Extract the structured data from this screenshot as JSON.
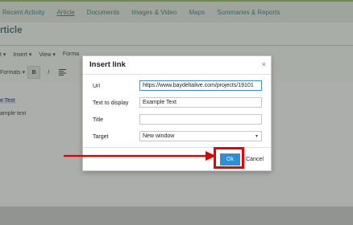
{
  "nav": {
    "items": [
      "Recent Activity",
      "Article",
      "Documents",
      "Images & Video",
      "Maps",
      "Summaries & Reports"
    ]
  },
  "page": {
    "title": "rticle"
  },
  "editor": {
    "menubar": [
      "t ▾",
      "Insert ▾",
      "View ▾",
      "Forma"
    ],
    "toolbar_formats": "Formats ▾",
    "bold_label": "B",
    "italic_label": "I",
    "selected_text": "e Text",
    "second_line": "ample text"
  },
  "dialog": {
    "title": "Insert link",
    "close_label": "×",
    "url_label": "Url",
    "url_value": "https://www.baydeltalive.com/projects/19101",
    "text_label": "Text to display",
    "text_value": "Example Text",
    "title_label": "Title",
    "title_value": "",
    "target_label": "Target",
    "target_value": "New window",
    "ok_label": "Ok",
    "cancel_label": "Cancel"
  },
  "annotation": {
    "arrow_color": "#e00000",
    "highlight_color": "#e00000"
  }
}
